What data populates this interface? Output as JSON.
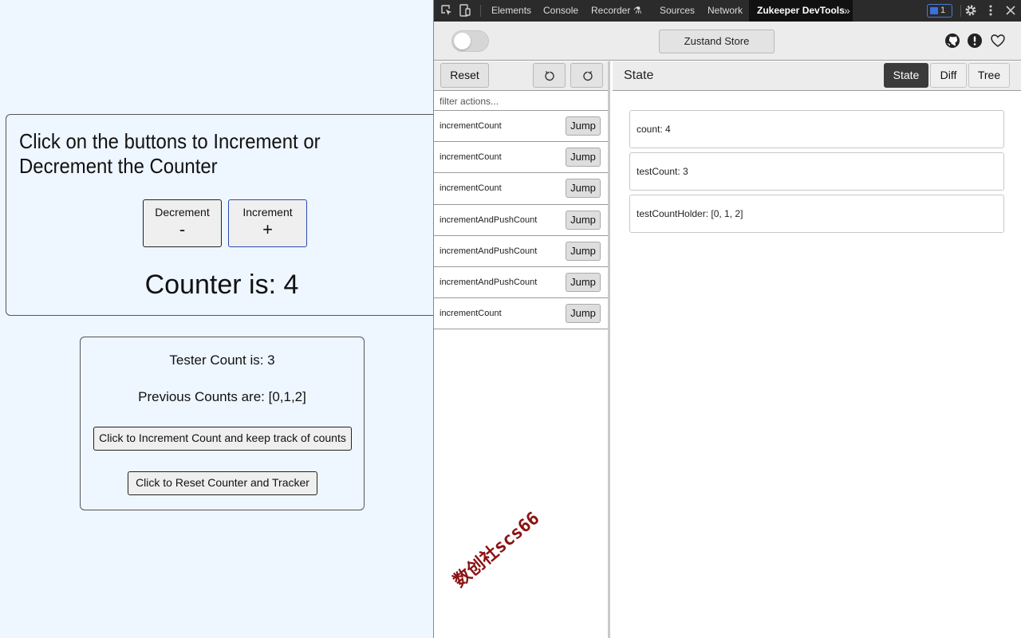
{
  "app": {
    "instruction": "Click on the buttons to Increment or Decrement the Counter",
    "decrement_label": "Decrement",
    "decrement_symbol": "-",
    "increment_label": "Increment",
    "increment_symbol": "+",
    "counter_text": "Counter is: 4",
    "tester_count_text": "Tester Count is: 3",
    "previous_counts_text": "Previous Counts are: [0,1,2]",
    "increment_track_button": "Click to Increment Count and keep track of counts",
    "reset_button": "Click to Reset Counter and Tracker"
  },
  "devtools": {
    "tabs": [
      {
        "label": "Elements"
      },
      {
        "label": "Console"
      },
      {
        "label": "Recorder ⚗"
      },
      {
        "label": "Sources"
      },
      {
        "label": "Network"
      },
      {
        "label": "Zukeeper DevTools",
        "active": true
      }
    ],
    "more_tabs": "»",
    "issues_count": "1",
    "accent_color": "#3c6fe0"
  },
  "zukeeper": {
    "store_button": "Zustand Store",
    "header_icons": [
      "github-icon",
      "alert-icon",
      "heart-icon"
    ],
    "reset_label": "Reset",
    "filter_placeholder": "filter actions...",
    "jump_label": "Jump",
    "actions": [
      {
        "name": "incrementCount"
      },
      {
        "name": "incrementCount"
      },
      {
        "name": "incrementCount"
      },
      {
        "name": "incrementAndPushCount"
      },
      {
        "name": "incrementAndPushCount"
      },
      {
        "name": "incrementAndPushCount"
      },
      {
        "name": "incrementCount"
      }
    ],
    "state_title": "State",
    "view_tabs": [
      {
        "label": "State",
        "active": true
      },
      {
        "label": "Diff"
      },
      {
        "label": "Tree"
      }
    ],
    "state_items": [
      {
        "text": "count: 4"
      },
      {
        "text": "testCount: 3"
      },
      {
        "text": "testCountHolder: [0, 1, 2]"
      }
    ]
  },
  "watermark": "数创社scs66"
}
